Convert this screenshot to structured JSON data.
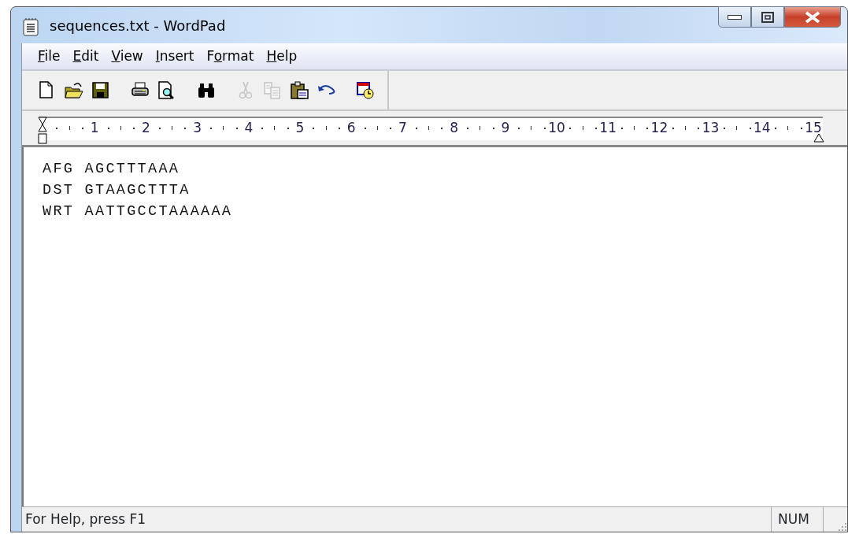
{
  "window": {
    "title": "sequences.txt - WordPad"
  },
  "menu": [
    {
      "access_key": "F",
      "rest": "ile"
    },
    {
      "access_key": "E",
      "rest": "dit"
    },
    {
      "access_key": "V",
      "rest": "iew"
    },
    {
      "access_key": "I",
      "rest": "nsert"
    },
    {
      "lead": "F",
      "access_key": "o",
      "rest": "rmat"
    },
    {
      "access_key": "H",
      "rest": "elp"
    }
  ],
  "toolbar": [
    {
      "kind": "new",
      "disabled": false
    },
    {
      "kind": "open",
      "disabled": false
    },
    {
      "kind": "save",
      "disabled": false
    },
    {
      "kind": "sep"
    },
    {
      "kind": "print",
      "disabled": false
    },
    {
      "kind": "preview",
      "disabled": false
    },
    {
      "kind": "sep"
    },
    {
      "kind": "find",
      "disabled": false
    },
    {
      "kind": "sep"
    },
    {
      "kind": "cut",
      "disabled": true
    },
    {
      "kind": "copy",
      "disabled": true
    },
    {
      "kind": "paste",
      "disabled": false
    },
    {
      "kind": "undo",
      "disabled": false
    },
    {
      "kind": "sep"
    },
    {
      "kind": "datetime",
      "disabled": false
    }
  ],
  "ruler": {
    "numbers": [
      "1",
      "2",
      "3",
      "4",
      "5",
      "6",
      "7",
      "8",
      "9",
      "10",
      "11",
      "12",
      "13",
      "14",
      "15"
    ]
  },
  "document": {
    "lines": [
      "AFG AGCTTTAAA",
      "DST GTAAGCTTTA",
      "WRT AATTGCCTAAAAAA"
    ]
  },
  "status_bar": {
    "message": "For Help, press F1",
    "indicator": "NUM"
  }
}
